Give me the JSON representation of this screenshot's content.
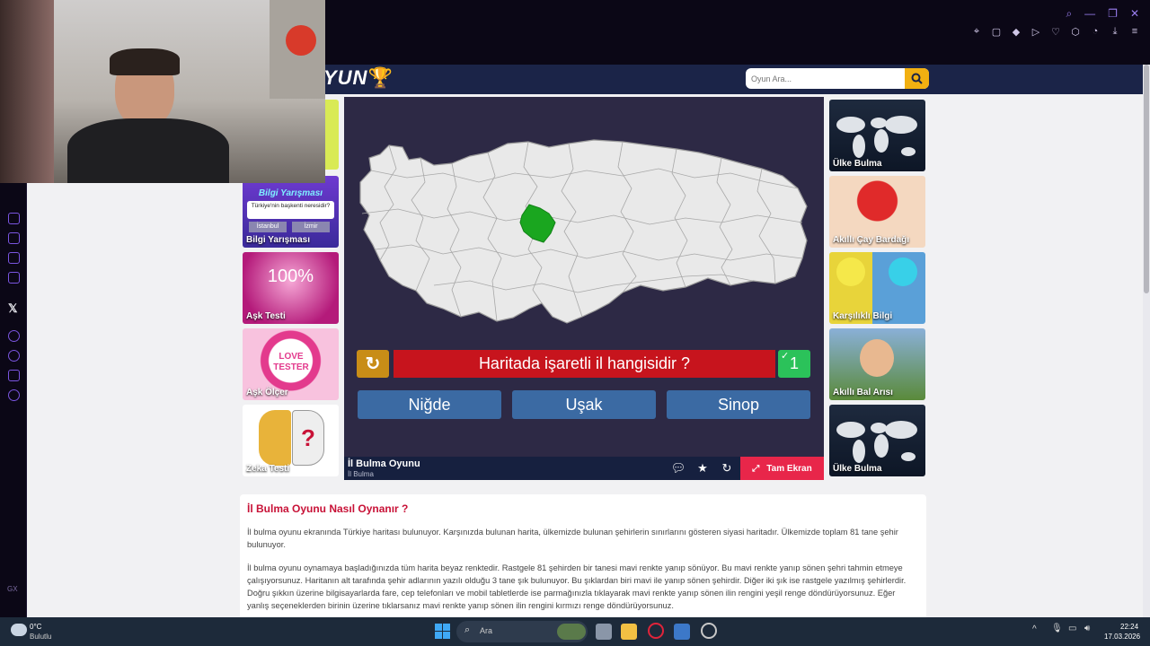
{
  "site": {
    "logo_text": "YUN",
    "search_placeholder": "Oyun Ara..."
  },
  "left_games": [
    {
      "label": "Bilgi Yarışması",
      "banner": "Bilgi Yarışması",
      "question": "Türkiye'nin başkenti neresidir?",
      "opt1": "İstanbul",
      "opt2": "İzmir"
    },
    {
      "label": "Aşk Testi",
      "big": "100%"
    },
    {
      "label": "Aşk Ölçer",
      "big": "LOVE TESTER"
    },
    {
      "label": "Zeka Testi"
    }
  ],
  "right_games": [
    {
      "label": "Ülke Bulma"
    },
    {
      "label": "Akıllı Çay Bardağı"
    },
    {
      "label": "Karşılıklı Bilgi"
    },
    {
      "label": "Akıllı Bal Arısı"
    },
    {
      "label": "Ülke Bulma"
    }
  ],
  "game": {
    "question": "Haritada işaretli il hangisidir ?",
    "score": "1",
    "answers": [
      "Niğde",
      "Uşak",
      "Sinop"
    ],
    "title": "İl Bulma Oyunu",
    "subtitle": "İl Bulma",
    "fullscreen_label": "Tam Ekran"
  },
  "article": {
    "heading": "İl Bulma Oyunu Nasıl Oynanır ?",
    "p1": "İl bulma oyunu ekranında Türkiye haritası bulunuyor. Karşınızda bulunan harita, ülkemizde bulunan şehirlerin sınırlarını gösteren siyasi haritadır. Ülkemizde toplam 81 tane şehir bulunuyor.",
    "p2": "İl bulma oyunu oynamaya başladığınızda tüm harita beyaz renktedir. Rastgele 81 şehirden bir tanesi mavi renkte yanıp sönüyor. Bu mavi renkte yanıp sönen şehri tahmin etmeye çalışıyorsunuz. Haritanın alt tarafında şehir adlarının yazılı olduğu 3 tane şık bulunuyor. Bu şıklardan biri mavi ile yanıp sönen şehirdir. Diğer iki şık ise rastgele yazılmış şehirlerdir. Doğru şıkkın üzerine bilgisayarlarda fare, cep telefonları ve mobil tabletlerde ise parmağınızla tıklayarak mavi renkte yanıp sönen ilin rengini yeşil renge döndürüyorsunuz. Eğer yanlış seçeneklerden birinin üzerine tıklarsanız mavi renkte yanıp sönen ilin rengini kırmızı renge döndürüyorsunuz."
  },
  "taskbar": {
    "temp": "0°C",
    "weather": "Bulutlu",
    "search_label": "Ara",
    "time": "22:24",
    "date": "17.03.2026"
  },
  "rail": {
    "gx": "GX"
  },
  "colors": {
    "accent": "#c7141d",
    "correct": "#2bc25a",
    "answer": "#3b6aa3",
    "header": "#1b2448"
  }
}
